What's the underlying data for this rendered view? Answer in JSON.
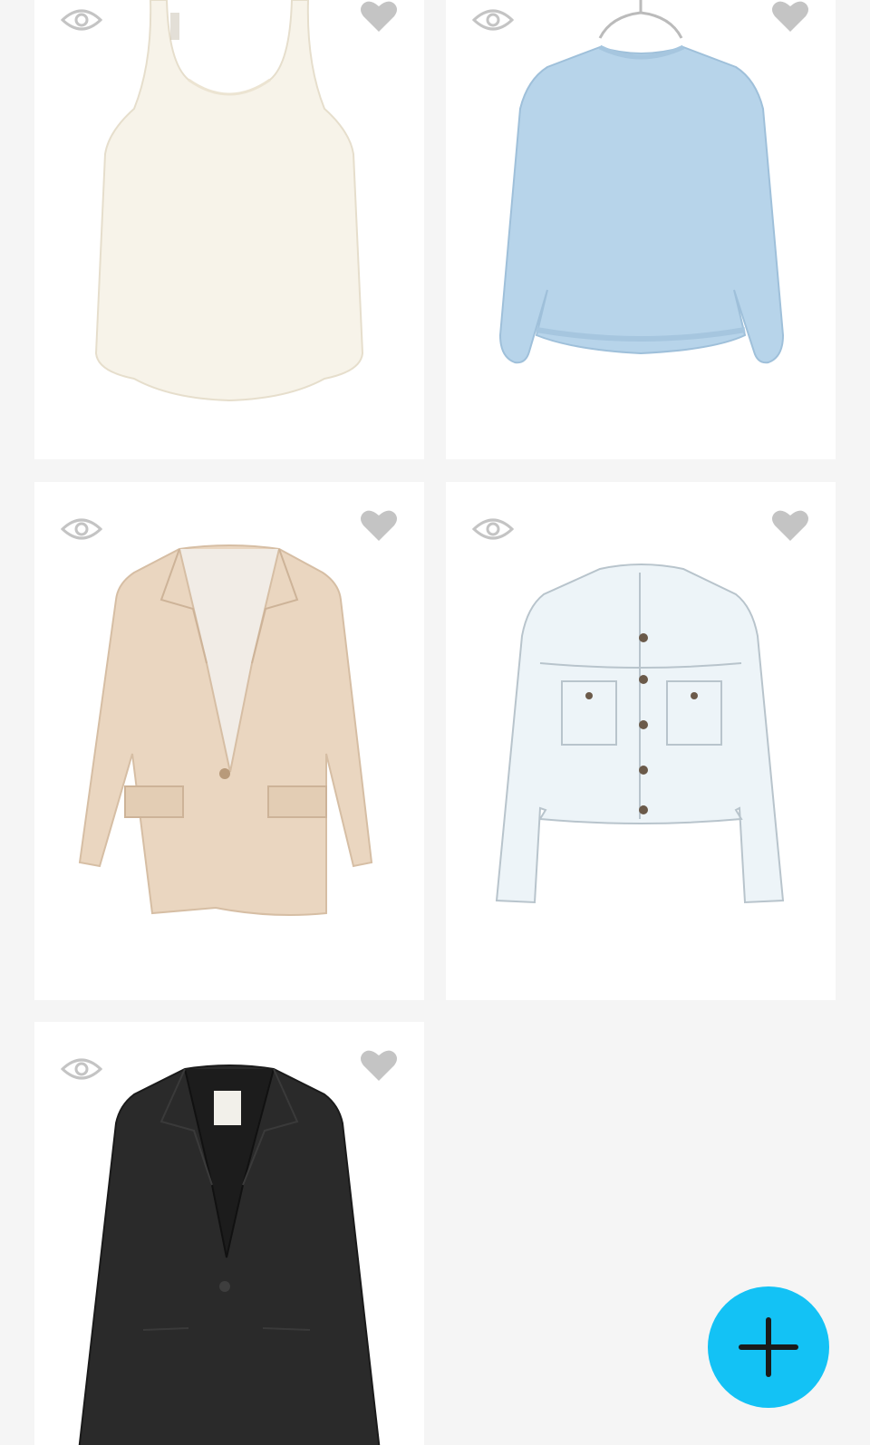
{
  "colors": {
    "background": "#f5f5f5",
    "card": "#ffffff",
    "icon_gray": "#c4c4c4",
    "fab": "#13c2f5",
    "fab_icon": "#1a1a1a"
  },
  "items": [
    {
      "name": "white-tank-top",
      "icons": [
        "eye-icon",
        "heart-icon"
      ]
    },
    {
      "name": "light-blue-sweatshirt",
      "icons": [
        "eye-icon",
        "heart-icon"
      ]
    },
    {
      "name": "beige-blazer",
      "icons": [
        "eye-icon",
        "heart-icon"
      ]
    },
    {
      "name": "white-denim-jacket",
      "icons": [
        "eye-icon",
        "heart-icon"
      ]
    },
    {
      "name": "black-blazer",
      "icons": [
        "eye-icon",
        "heart-icon"
      ]
    }
  ],
  "fab": {
    "icon": "plus-icon"
  }
}
